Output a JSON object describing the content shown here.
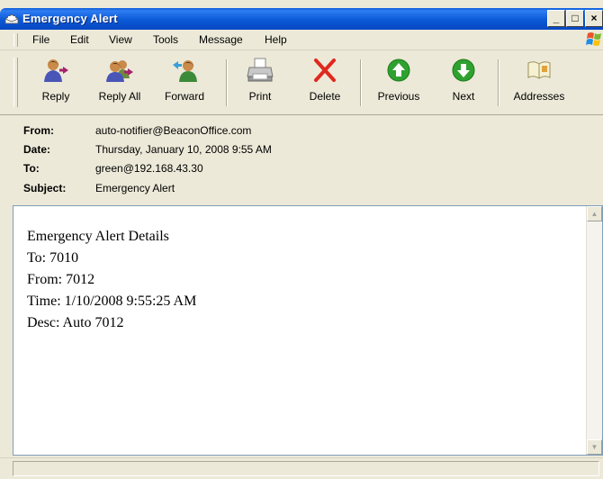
{
  "window": {
    "title": "Emergency Alert",
    "controls": {
      "minimize": "_",
      "maximize": "□",
      "close": "×"
    }
  },
  "menu": [
    "File",
    "Edit",
    "View",
    "Tools",
    "Message",
    "Help"
  ],
  "toolbar": {
    "reply": "Reply",
    "reply_all": "Reply All",
    "forward": "Forward",
    "print": "Print",
    "delete": "Delete",
    "previous": "Previous",
    "next": "Next",
    "addresses": "Addresses"
  },
  "headers": {
    "from_label": "From:",
    "from": "auto-notifier@BeaconOffice.com",
    "date_label": "Date:",
    "date": "Thursday, January 10, 2008 9:55 AM",
    "to_label": "To:",
    "to": "green@192.168.43.30",
    "subject_label": "Subject:",
    "subject": "Emergency Alert"
  },
  "body": {
    "lines": [
      "Emergency Alert Details",
      "To: 7010",
      "From: 7012",
      "Time: 1/10/2008 9:55:25 AM",
      "Desc: Auto 7012"
    ]
  },
  "colors": {
    "titlebar": "#0b59d6",
    "chrome": "#ece9d8",
    "delete_red": "#e0281e",
    "nav_green": "#2fa12f"
  }
}
